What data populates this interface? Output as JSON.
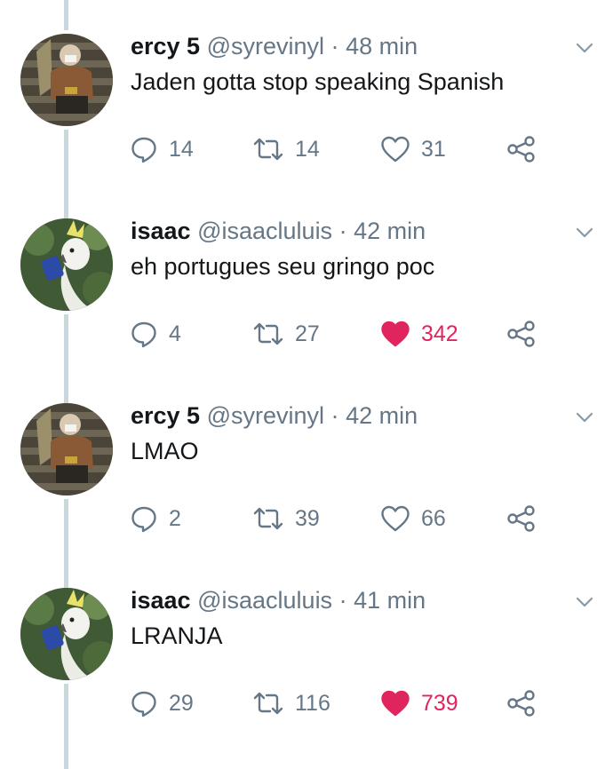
{
  "tweets": [
    {
      "name": "ercy 5",
      "handle": "@syrevinyl",
      "separator": "·",
      "time": "48 min",
      "text": "Jaden gotta stop speaking Spanish",
      "replies": "14",
      "retweets": "14",
      "likes": "31",
      "liked": false,
      "avatar": "person-on-stairs"
    },
    {
      "name": "isaac",
      "handle": "@isaacluluis",
      "separator": "·",
      "time": "42 min",
      "text": "eh portugues seu gringo poc",
      "replies": "4",
      "retweets": "27",
      "likes": "342",
      "liked": true,
      "avatar": "cockatoo"
    },
    {
      "name": "ercy 5",
      "handle": "@syrevinyl",
      "separator": "·",
      "time": "42 min",
      "text": "LMAO",
      "replies": "2",
      "retweets": "39",
      "likes": "66",
      "liked": false,
      "avatar": "person-on-stairs"
    },
    {
      "name": "isaac",
      "handle": "@isaacluluis",
      "separator": "·",
      "time": "41 min",
      "text": "LRANJA",
      "replies": "29",
      "retweets": "116",
      "likes": "739",
      "liked": true,
      "avatar": "cockatoo"
    }
  ],
  "colors": {
    "text": "#14171a",
    "secondary": "#657786",
    "like_active": "#e0245e",
    "thread_line": "#ccd6dd"
  }
}
